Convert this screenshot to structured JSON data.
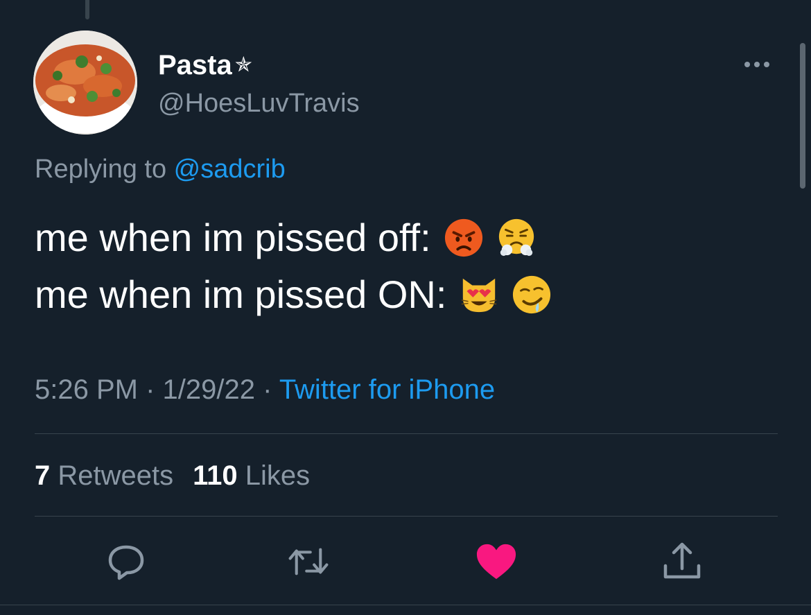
{
  "author": {
    "display_name": "Pasta",
    "badge": "✯",
    "handle": "@HoesLuvTravis",
    "avatar_icon": "pasta-bowl"
  },
  "reply": {
    "prefix": "Replying to ",
    "mention": "@sadcrib"
  },
  "tweet": {
    "lines": [
      {
        "text": "me when im pissed off:",
        "emojis": [
          "angry-face",
          "face-with-steam-from-nose"
        ]
      },
      {
        "text": "me when im pissed ON:",
        "emojis": [
          "smiling-cat-with-heart-eyes",
          "drooling-face"
        ]
      }
    ]
  },
  "meta": {
    "time": "5:26 PM",
    "sep1": " · ",
    "date": "1/29/22",
    "sep2": " · ",
    "source": "Twitter for iPhone"
  },
  "stats": {
    "retweets_count": "7",
    "retweets_label": " Retweets",
    "likes_count": "110",
    "likes_label": " Likes"
  },
  "actions": {
    "reply_icon": "reply-icon",
    "retweet_icon": "retweet-icon",
    "like_icon": "heart-icon",
    "share_icon": "share-icon",
    "liked": true,
    "like_color": "#f91880"
  },
  "colors": {
    "background": "#15202b",
    "secondary_text": "#8b98a5",
    "link": "#1d9bf0"
  }
}
